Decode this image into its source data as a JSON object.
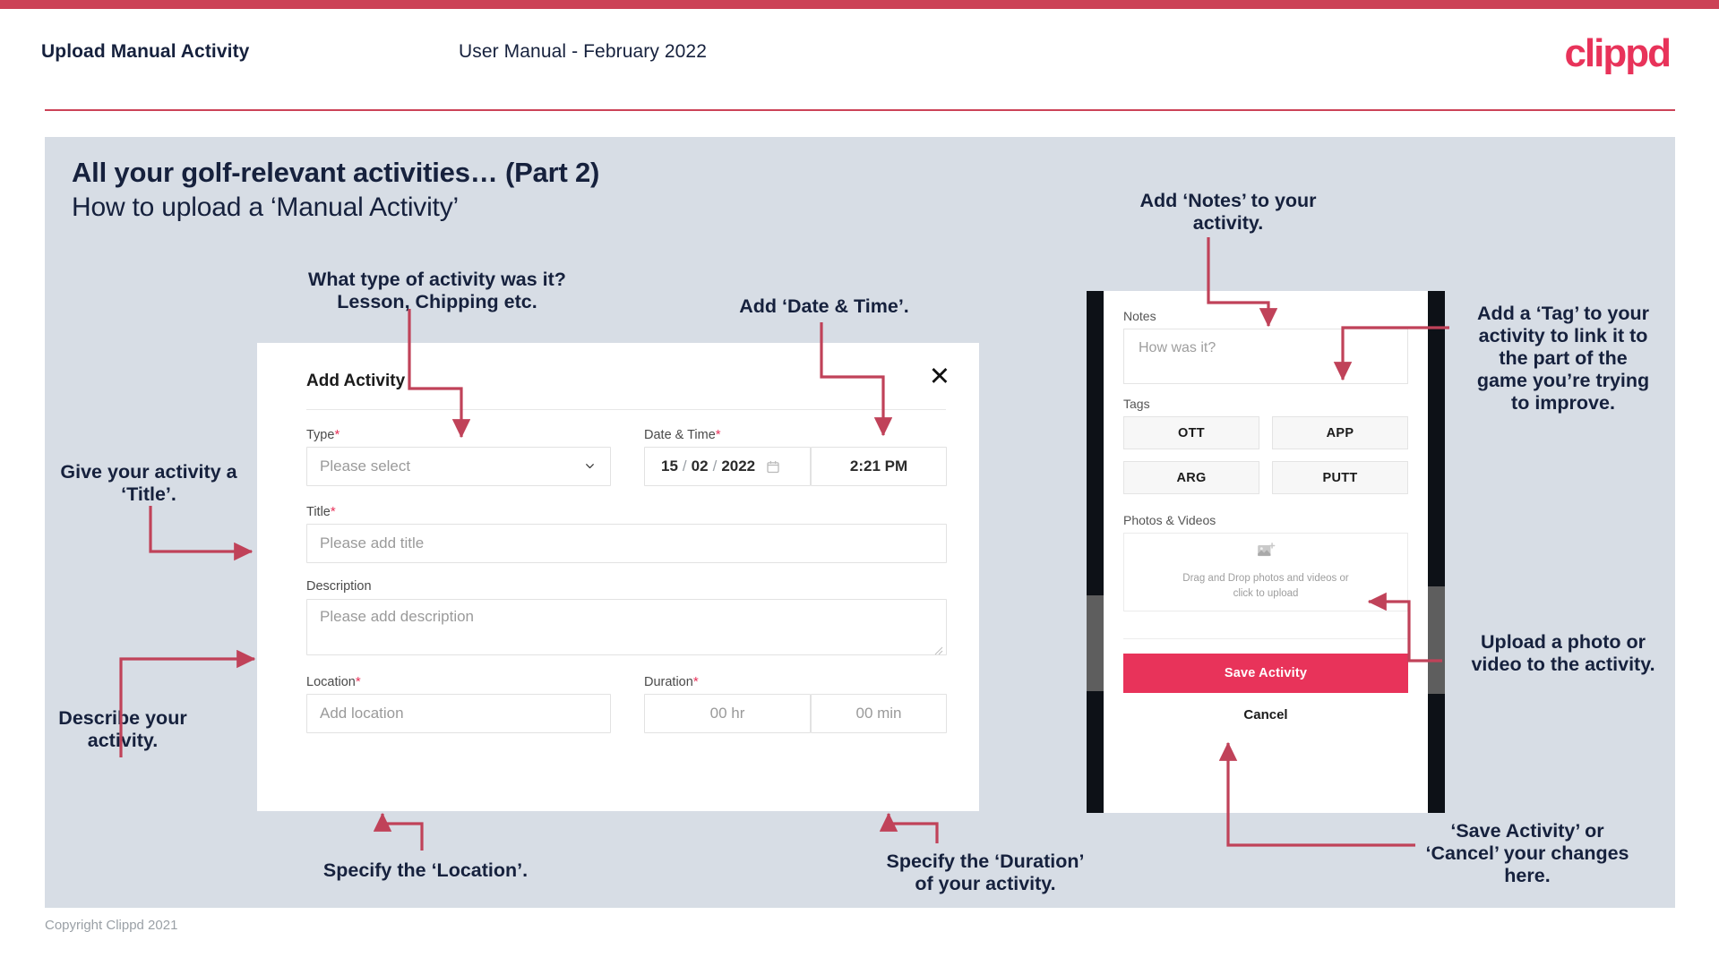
{
  "header": {
    "title": "Upload Manual Activity",
    "subtitle": "User Manual - February 2022",
    "logo": "clippd"
  },
  "slide": {
    "heading": "All your golf-relevant activities… (Part 2)",
    "subheading": "How to upload a ‘Manual Activity’"
  },
  "annotations": {
    "type": "What type of activity was it?\nLesson, Chipping etc.",
    "datetime": "Add ‘Date & Time’.",
    "title": "Give your activity a\n‘Title’.",
    "description": "Describe your\nactivity.",
    "location": "Specify the ‘Location’.",
    "duration": "Specify the ‘Duration’\nof your activity.",
    "notes": "Add ‘Notes’ to your\nactivity.",
    "tags": "Add a ‘Tag’ to your\nactivity to link it to\nthe part of the\ngame you’re trying\nto improve.",
    "photos": "Upload a photo or\nvideo to the activity.",
    "save": "‘Save Activity’ or\n‘Cancel’ your changes\nhere."
  },
  "dialog": {
    "title": "Add Activity",
    "close_icon": "close-icon",
    "fields": {
      "type": {
        "label": "Type",
        "required": "*",
        "placeholder": "Please select"
      },
      "datetime": {
        "label": "Date & Time",
        "required": "*",
        "day": "15",
        "month": "02",
        "year": "2022",
        "sep1": "/",
        "sep2": "/",
        "time": "2:21 PM"
      },
      "title": {
        "label": "Title",
        "required": "*",
        "placeholder": "Please add title"
      },
      "description": {
        "label": "Description",
        "placeholder": "Please add description"
      },
      "location": {
        "label": "Location",
        "required": "*",
        "placeholder": "Add location"
      },
      "duration": {
        "label": "Duration",
        "required": "*",
        "hours": "00 hr",
        "minutes": "00 min"
      }
    }
  },
  "phone": {
    "notes": {
      "label": "Notes",
      "placeholder": "How was it?"
    },
    "tags": {
      "label": "Tags",
      "items": [
        "OTT",
        "APP",
        "ARG",
        "PUTT"
      ]
    },
    "photos": {
      "label": "Photos & Videos",
      "dropzone_line1": "Drag and Drop photos and videos or",
      "dropzone_line2": "click to upload",
      "icon": "add-image-icon"
    },
    "save_label": "Save Activity",
    "cancel_label": "Cancel"
  },
  "footer": {
    "copyright": "Copyright Clippd 2021"
  },
  "colors": {
    "brand_pink": "#e8335a",
    "annotation_line": "#c04259",
    "top_bar": "#cc4257",
    "slide_bg": "#d7dde5",
    "navy_text": "#16213d"
  }
}
